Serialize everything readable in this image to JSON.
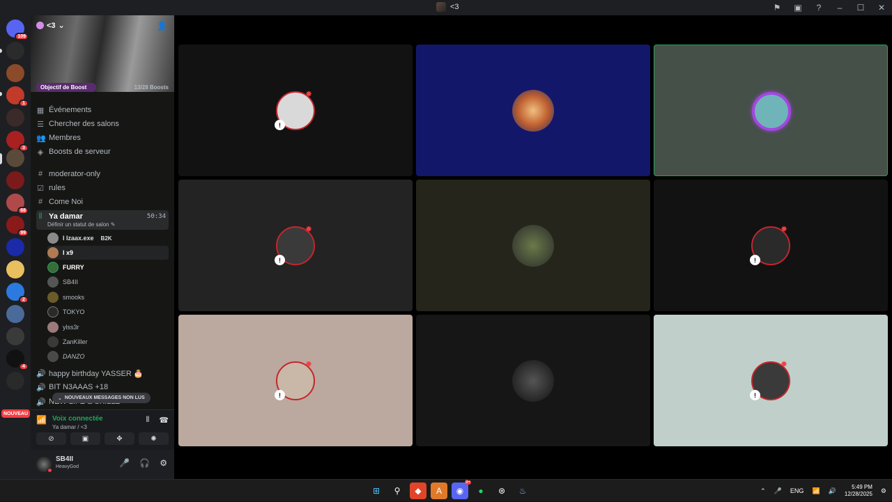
{
  "window": {
    "title": "<3"
  },
  "banner": {
    "server_name": "<3"
  },
  "boost": {
    "goal_label": "Objectif de Boost",
    "count": "13/28 Boosts"
  },
  "menu": [
    {
      "label": "Événements",
      "icon": "calendar-icon"
    },
    {
      "label": "Chercher des salons",
      "icon": "list-icon"
    },
    {
      "label": "Membres",
      "icon": "members-icon"
    },
    {
      "label": "Boosts de serveur",
      "icon": "boost-icon"
    }
  ],
  "channels": [
    {
      "label": "moderator-only",
      "icon": "hash-icon"
    },
    {
      "label": "rules",
      "icon": "rules-icon"
    },
    {
      "label": "Come Noi",
      "icon": "hash-icon"
    }
  ],
  "active_channel": {
    "label": "Ya damar",
    "timer": "50:34",
    "status": "Définir un statut de salon"
  },
  "voice_users": [
    {
      "name": "I Izaax.exe",
      "tag": "B2K",
      "color": "#8a8a8a"
    },
    {
      "name": "I x9",
      "color": "#b07a55"
    },
    {
      "name": "FURRY",
      "color": "#3a6b3a"
    },
    {
      "name": "SB4II",
      "color": "#555555"
    },
    {
      "name": "smooks",
      "color": "#6b5a2a"
    },
    {
      "name": "TOKYO",
      "color": "#2a2a2a"
    },
    {
      "name": "ylss3r",
      "color": "#9a7a7a"
    },
    {
      "name": "ZanKiller",
      "color": "#3a3a3a"
    },
    {
      "name": "DANZO",
      "color": "#4a4a4a"
    }
  ],
  "more_channels": [
    {
      "label": "happy birthday YASSER 🎂"
    },
    {
      "label": "BIT N3AAAS +18"
    },
    {
      "label": "NEW LIFE & SKILLZ"
    }
  ],
  "new_messages": "NOUVEAUX MESSAGES NON LUS",
  "nouveau_badge": "NOUVEAU",
  "voice_panel": {
    "title": "Voix connectée",
    "subtitle": "Ya damar / <3"
  },
  "user": {
    "name": "SB4II",
    "status": "HeavyGod"
  },
  "server_badges": [
    "109",
    "1",
    "3",
    "68",
    "99",
    "2",
    "4"
  ],
  "tiles": [
    {
      "bg": "#121212",
      "avatar": "#d9d9d9",
      "deafened": true
    },
    {
      "bg": "#13176a",
      "avatar": "#e8a060",
      "deafened": false
    },
    {
      "bg": "#455049",
      "avatar": "#6fb4b8",
      "deafened": false,
      "speaking": true
    },
    {
      "bg": "#232323",
      "avatar": "#3a3a3a",
      "deafened": true
    },
    {
      "bg": "#25251b",
      "avatar": "#4a5a3a",
      "deafened": false
    },
    {
      "bg": "#121212",
      "avatar": "#2a2a2a",
      "deafened": true
    },
    {
      "bg": "#bba89f",
      "avatar": "#c9b7a8",
      "deafened": true
    },
    {
      "bg": "#161616",
      "avatar": "#1a1a1a",
      "deafened": false
    },
    {
      "bg": "#c0cfc9",
      "avatar": "#3a3a3a",
      "deafened": true
    }
  ],
  "taskbar": {
    "lang": "ENG",
    "time": "5:49 PM",
    "date": "12/28/2025",
    "discord_badge": "9+"
  }
}
